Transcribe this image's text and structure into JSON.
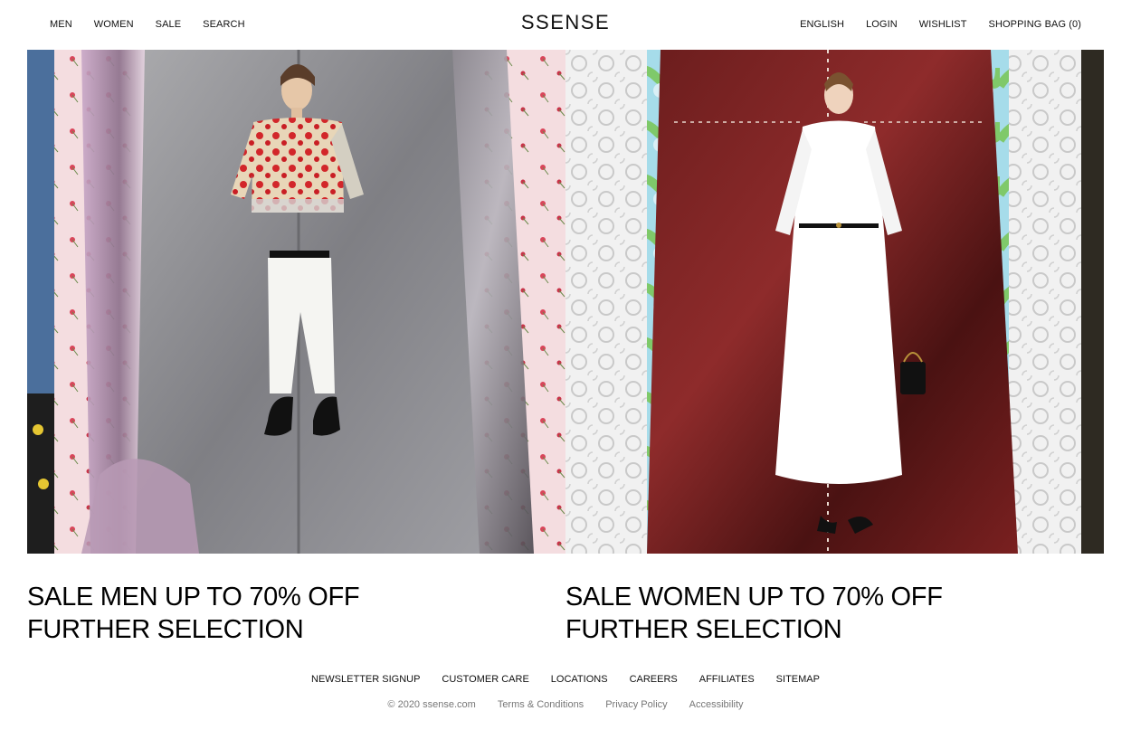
{
  "header": {
    "nav_left": [
      "MEN",
      "WOMEN",
      "SALE",
      "SEARCH"
    ],
    "logo": "SSENSE",
    "nav_right": [
      "ENGLISH",
      "LOGIN",
      "WISHLIST",
      "SHOPPING BAG (0)"
    ]
  },
  "hero": {
    "men": {
      "line1": "SALE MEN UP TO 70% OFF",
      "line2": "FURTHER SELECTION"
    },
    "women": {
      "line1": "SALE WOMEN UP TO 70% OFF",
      "line2": "FURTHER SELECTION"
    }
  },
  "footer": {
    "links": [
      "NEWSLETTER SIGNUP",
      "CUSTOMER CARE",
      "LOCATIONS",
      "CAREERS",
      "AFFILIATES",
      "SITEMAP"
    ],
    "copyright": "© 2020 ssense.com",
    "legal": [
      "Terms & Conditions",
      "Privacy Policy",
      "Accessibility"
    ]
  },
  "colors": {
    "text": "#111111",
    "legal_text": "#777777",
    "background": "#ffffff"
  }
}
